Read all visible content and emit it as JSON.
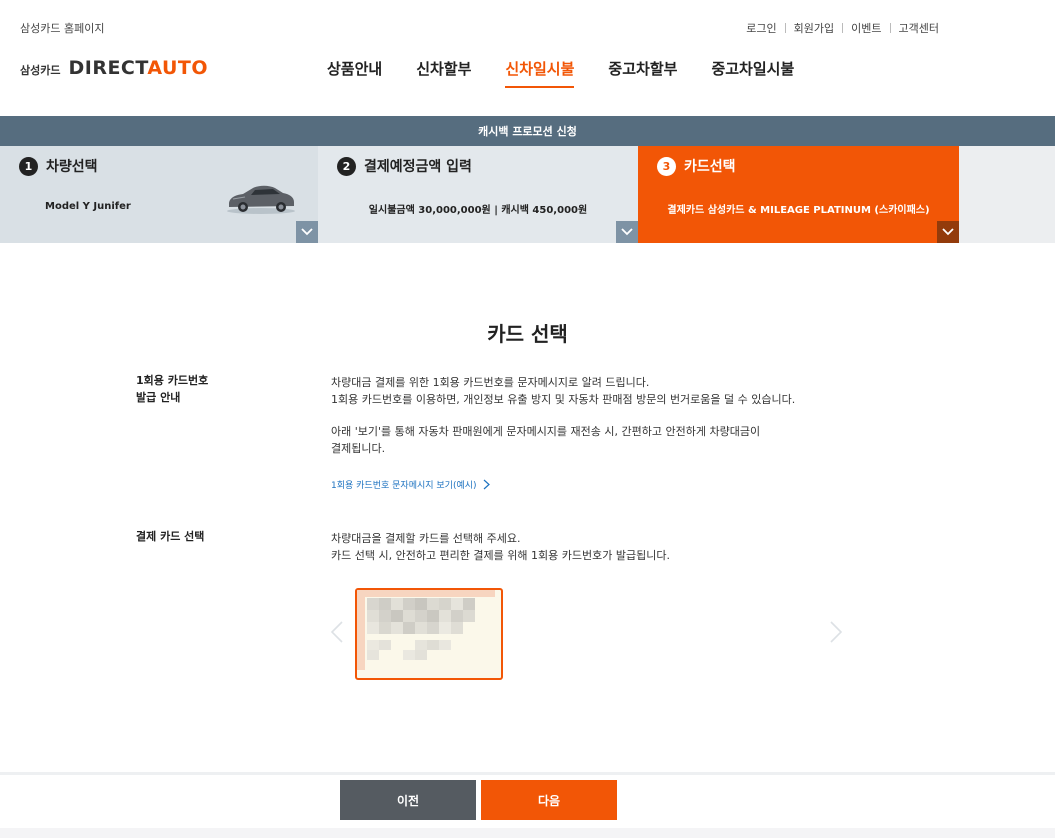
{
  "header": {
    "home_link": "삼성카드 홈페이지",
    "util": [
      "로그인",
      "회원가입",
      "이벤트",
      "고객센터"
    ],
    "logo_small": "삼성카드",
    "logo_main": "DIRECT",
    "logo_accent": "AUTO",
    "nav": [
      "상품안내",
      "신차할부",
      "신차일시불",
      "중고차할부",
      "중고차일시불"
    ],
    "nav_active": "신차일시불"
  },
  "promo_bar": "캐시백 프로모션 신청",
  "steps": [
    {
      "num": "1",
      "title": "차량선택",
      "sub": "Model Y Junifer"
    },
    {
      "num": "2",
      "title": "결제예정금액 입력",
      "sub": "일시불금액 30,000,000원  |  캐시백 450,000원"
    },
    {
      "num": "3",
      "title": "카드선택",
      "sub": "결제카드 삼성카드 & MILEAGE PLATINUM (스카이패스)"
    }
  ],
  "content": {
    "title": "카드 선택",
    "otp_label_1": "1회용 카드번호",
    "otp_label_2": "발급 안내",
    "otp_desc_1": "차량대금 결제를 위한 1회용 카드번호를 문자메시지로 알려 드립니다.",
    "otp_desc_2": "1회용 카드번호를 이용하면, 개인정보 유출 방지 및 자동차 판매점 방문의 번거로움을 덜 수 있습니다.",
    "otp_desc_3": "아래 '보기'를 통해 자동차 판매원에게 문자메시지를 재전송 시, 간편하고 안전하게 차량대금이",
    "otp_desc_4": "결제됩니다.",
    "otp_link": "1회용 카드번호 문자메시지 보기(예시)",
    "card_label": "결제 카드 선택",
    "card_desc_1": "차량대금을 결제할 카드를 선택해 주세요.",
    "card_desc_2": "카드 선택 시, 안전하고 편리한 결제를 위해 1회용 카드번호가 발급됩니다."
  },
  "footer": {
    "prev": "이전",
    "next": "다음"
  },
  "colors": {
    "accent": "#f25606",
    "promo_bg": "#566d7f",
    "prev_btn": "#555b61"
  }
}
